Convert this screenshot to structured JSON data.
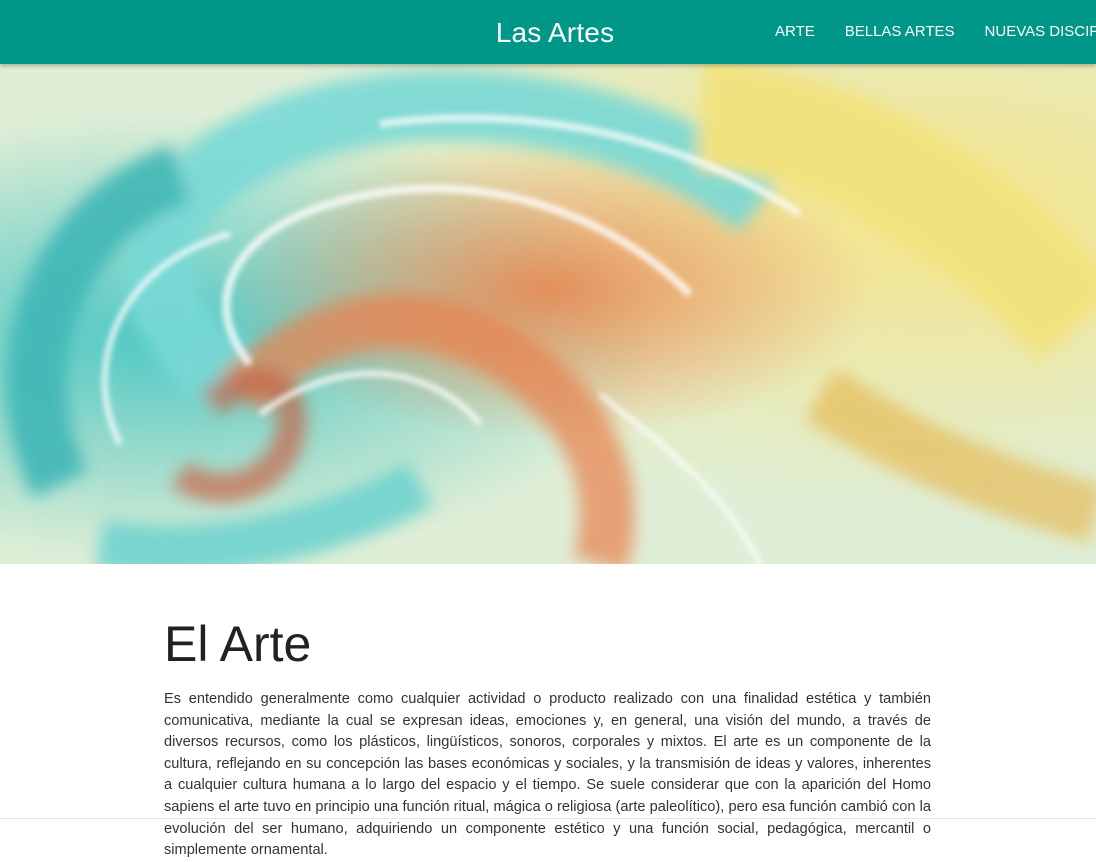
{
  "navbar": {
    "brand": "Las Artes",
    "links": [
      "ARTE",
      "BELLAS ARTES",
      "NUEVAS DISCIPLINAS"
    ],
    "background_color": "#009688"
  },
  "hero": {
    "image_description": "abstract-swirl-painting",
    "colors": [
      "#5fd2d0",
      "#e8764a",
      "#f3e57e",
      "#ffffff"
    ]
  },
  "article": {
    "title": "El Arte",
    "body": "Es entendido generalmente como cualquier actividad o producto realizado con una finalidad estética y también comunicativa, mediante la cual se expresan ideas, emociones y, en general, una visión del mundo, a través de diversos recursos, como los plásticos, lingüísticos, sonoros, corporales y mixtos. El arte es un componente de la cultura, reflejando en su concepción las bases económicas y sociales, y la transmisión de ideas y valores, inherentes a cualquier cultura humana a lo largo del espacio y el tiempo. Se suele considerar que con la aparición del Homo sapiens el arte tuvo en principio una función ritual, mágica o religiosa (arte paleolítico), pero esa función cambió con la evolución del ser humano, adquiriendo un componente estético y una función social, pedagógica, mercantil o simplemente ornamental."
  }
}
